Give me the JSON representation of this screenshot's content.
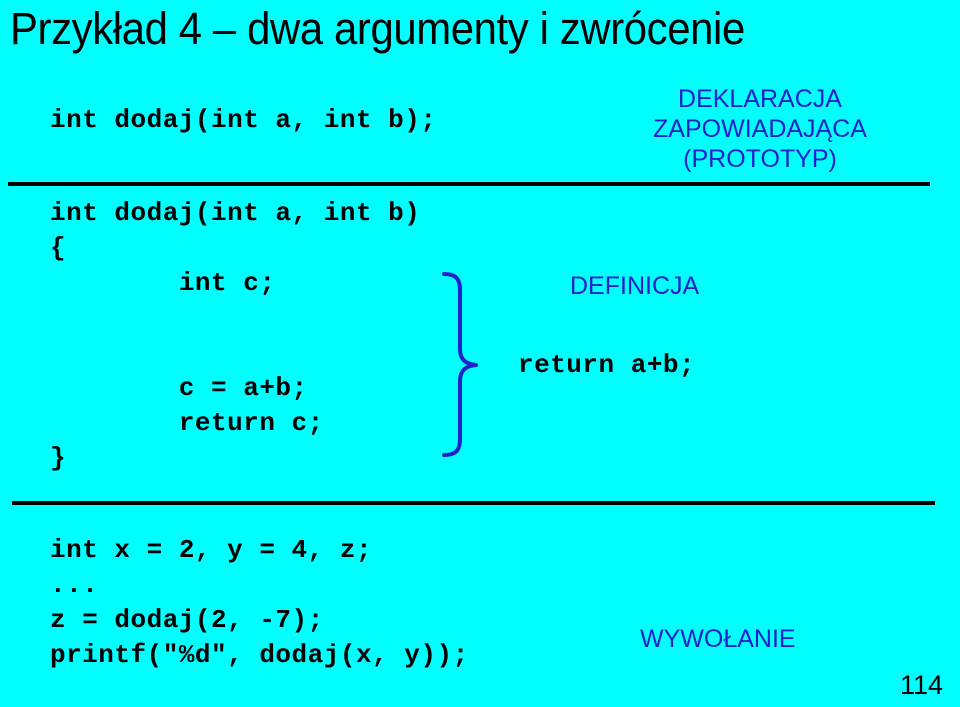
{
  "slide": {
    "title": "Przykład 4 – dwa argumenty i zwrócenie",
    "page_number": "114",
    "background_color": "#00ffff",
    "title_color": "#000000",
    "code_color": "#000000",
    "annotation_color": "#2020cc",
    "brace_color": "#2020cc"
  },
  "code": {
    "prototype": "int dodaj(int a, int b);",
    "definition": "int dodaj(int a, int b)\n{\n        int c;\n\n\n        c = a+b;\n        return c;\n}",
    "return_note": "return a+b;",
    "usage": "int x = 2, y = 4, z;\n...\nz = dodaj(2, -7);\nprintf(″%d″, dodaj(x, y));"
  },
  "annotations": {
    "declaration": "DEKLARACJA\nZAPOWIADAJĄCA\n(PROTOTYP)",
    "definition": "DEFINICJA",
    "call": "WYWOŁANIE"
  }
}
